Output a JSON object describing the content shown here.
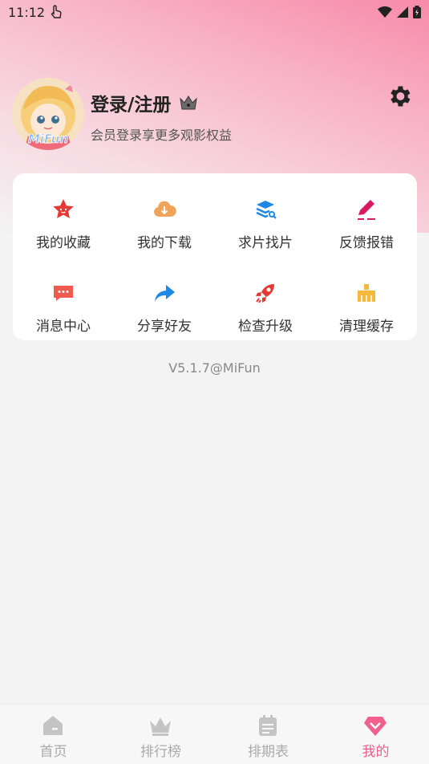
{
  "status_bar": {
    "time": "11:12"
  },
  "profile": {
    "title": "登录/注册",
    "subtitle": "会员登录享更多观影权益",
    "avatar_text": "MiFun"
  },
  "menu": {
    "items": [
      {
        "label": "我的收藏",
        "icon": "star-icon",
        "color": "#e53935"
      },
      {
        "label": "我的下载",
        "icon": "cloud-download-icon",
        "color": "#f0a35a"
      },
      {
        "label": "求片找片",
        "icon": "search-stack-icon",
        "color": "#1e88e5"
      },
      {
        "label": "反馈报错",
        "icon": "pencil-icon",
        "color": "#d81b60"
      },
      {
        "label": "消息中心",
        "icon": "message-icon",
        "color": "#f05b4f"
      },
      {
        "label": "分享好友",
        "icon": "share-icon",
        "color": "#1e88e5"
      },
      {
        "label": "检查升级",
        "icon": "rocket-icon",
        "color": "#e53935"
      },
      {
        "label": "清理缓存",
        "icon": "broom-icon",
        "color": "#f6b93b"
      }
    ]
  },
  "version": "V5.1.7@MiFun",
  "tabbar": {
    "tabs": [
      {
        "label": "首页",
        "icon": "home-icon",
        "active": false
      },
      {
        "label": "排行榜",
        "icon": "crown-icon",
        "active": false
      },
      {
        "label": "排期表",
        "icon": "calendar-icon",
        "active": false
      },
      {
        "label": "我的",
        "icon": "heart-diamond-icon",
        "active": true
      }
    ],
    "active_color": "#f25f8d",
    "inactive_color": "#aaaaaa"
  }
}
